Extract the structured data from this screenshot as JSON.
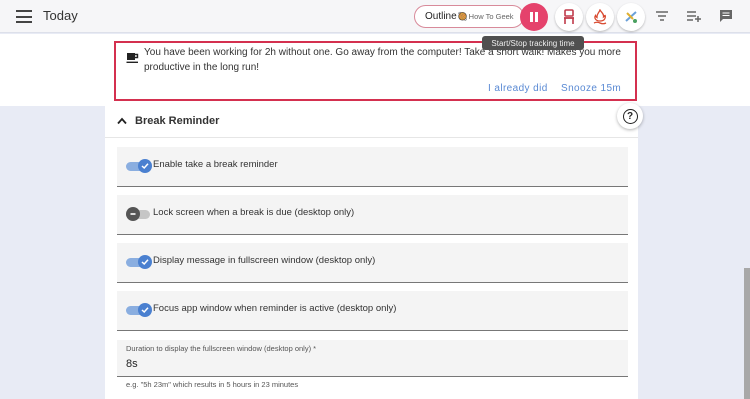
{
  "header": {
    "title": "Today",
    "chip": {
      "project": "Outline",
      "emoji": "🥘",
      "subtitle": "How To Geek"
    },
    "tooltip": "Start/Stop tracking time"
  },
  "banner": {
    "message_before": "You have been working for ",
    "duration": "2h",
    "message_after": " without one. Go away from the computer! Take a short walk! Makes you more productive in the long run!",
    "already_label": "I already did",
    "snooze_label": "Snooze 15m"
  },
  "panel": {
    "title": "Break Reminder",
    "rows": [
      {
        "label": "Enable take a break reminder",
        "on": true
      },
      {
        "label": "Lock screen when a break is due (desktop only)",
        "on": false
      },
      {
        "label": "Display message in fullscreen window (desktop only)",
        "on": true
      },
      {
        "label": "Focus app window when reminder is active (desktop only)",
        "on": true
      }
    ],
    "field": {
      "label": "Duration to display the fullscreen window (desktop only) *",
      "value": "8s",
      "hint": "e.g. \"5h 23m\" which results in 5 hours in 23 minutes"
    }
  },
  "colors": {
    "accent": "#e5426c",
    "toggle_on": "#4a80d0",
    "banner_border": "#d4304f",
    "link": "#5a8ad4"
  }
}
